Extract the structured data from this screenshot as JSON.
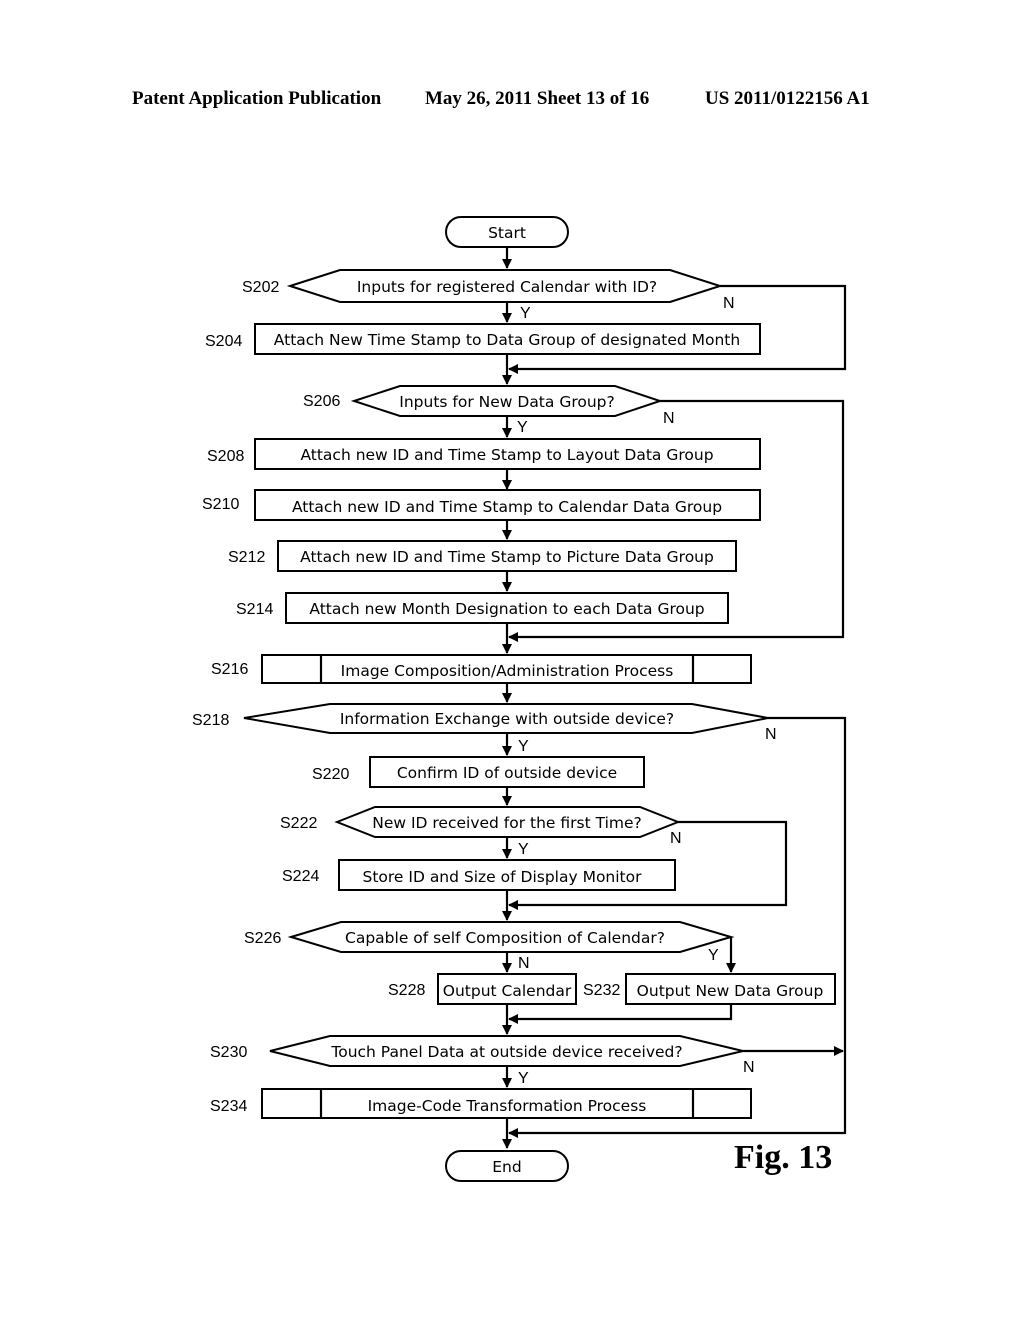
{
  "header": {
    "publication": "Patent Application Publication",
    "date_sheet": "May 26, 2011  Sheet 13 of 16",
    "number": "US 2011/0122156 A1"
  },
  "figure_label": "Fig. 13",
  "branch_labels": {
    "yes": "Y",
    "no": "N"
  },
  "terminals": {
    "start": "Start",
    "end": "End"
  },
  "steps": {
    "S202": {
      "id": "S202",
      "type": "decision",
      "text": "Inputs for registered Calendar with ID?"
    },
    "S204": {
      "id": "S204",
      "type": "process",
      "text": "Attach New Time Stamp to Data Group of designated Month"
    },
    "S206": {
      "id": "S206",
      "type": "decision",
      "text": "Inputs for New Data Group?"
    },
    "S208": {
      "id": "S208",
      "type": "process",
      "text": "Attach new ID and Time Stamp to Layout Data Group"
    },
    "S210": {
      "id": "S210",
      "type": "process",
      "text": "Attach new ID and Time Stamp to Calendar Data Group"
    },
    "S212": {
      "id": "S212",
      "type": "process",
      "text": "Attach new  ID and Time Stamp to Picture Data Group"
    },
    "S214": {
      "id": "S214",
      "type": "process",
      "text": "Attach new  Month Designation to each Data Group"
    },
    "S216": {
      "id": "S216",
      "type": "subprocess",
      "text": "Image Composition/Administration Process"
    },
    "S218": {
      "id": "S218",
      "type": "decision",
      "text": "Information Exchange with outside device?"
    },
    "S220": {
      "id": "S220",
      "type": "process",
      "text": "Confirm ID of outside device"
    },
    "S222": {
      "id": "S222",
      "type": "decision",
      "text": "New ID received for the first Time?"
    },
    "S224": {
      "id": "S224",
      "type": "process",
      "text": "Store ID and Size of Display Monitor"
    },
    "S226": {
      "id": "S226",
      "type": "decision",
      "text": "Capable of self Composition of Calendar?"
    },
    "S228": {
      "id": "S228",
      "type": "process",
      "text": "Output Calendar"
    },
    "S232": {
      "id": "S232",
      "type": "process",
      "text": "Output New Data Group"
    },
    "S230": {
      "id": "S230",
      "type": "decision",
      "text": "Touch Panel Data at outside device received?"
    },
    "S234": {
      "id": "S234",
      "type": "subprocess",
      "text": "Image-Code Transformation Process"
    }
  }
}
